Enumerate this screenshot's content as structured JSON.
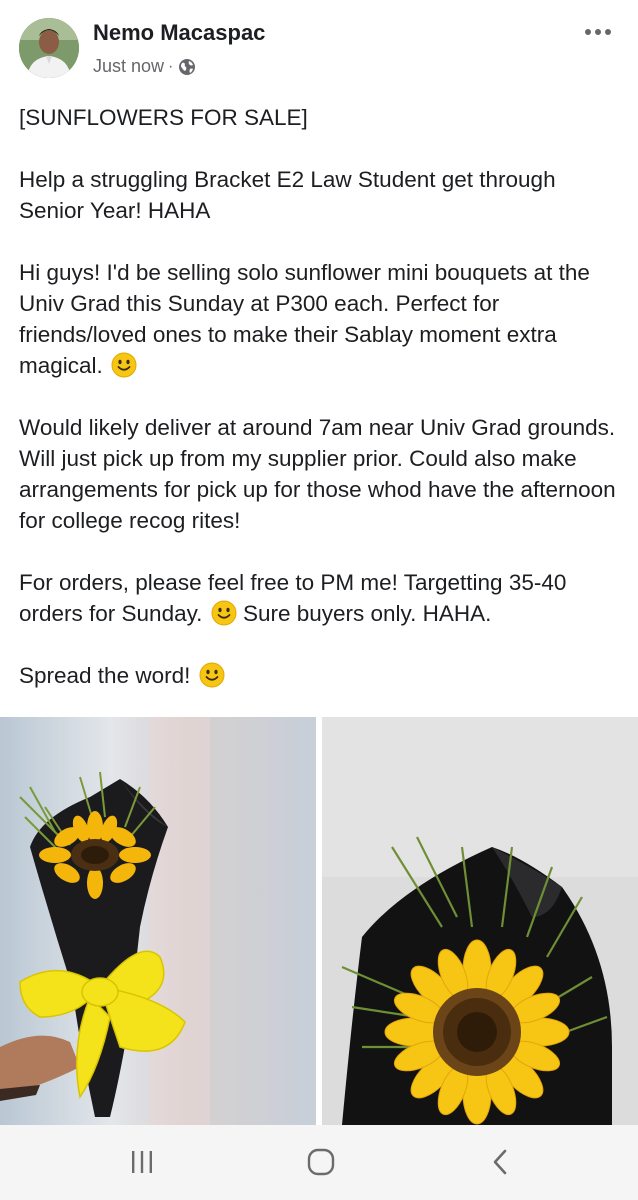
{
  "post": {
    "author": {
      "name": "Nemo Macaspac",
      "avatar_icon": "profile-photo"
    },
    "timestamp": "Just now",
    "separator": "·",
    "privacy_icon": "globe-icon",
    "more_icon": "more-options-icon",
    "paragraphs": [
      {
        "text": "[SUNFLOWERS FOR SALE]",
        "emoji_after": false
      },
      {
        "text": "Help a struggling Bracket E2 Law Student get through Senior Year! HAHA",
        "emoji_after": false
      },
      {
        "text": "Hi guys! I'd be selling solo sunflower mini bouquets at the Univ Grad this Sunday at P300 each. Perfect for friends/loved ones to make their Sablay moment extra magical.",
        "emoji_after": true
      },
      {
        "text": "Would likely deliver at around 7am near Univ Grad grounds. Will just pick up from my supplier prior. Could also make arrangements for pick up for those whod have the afternoon for college recog rites!",
        "emoji_after": false
      },
      {
        "text_before": "For orders, please feel free to PM me! Targetting 35-40 orders for Sunday.",
        "text_after": "Sure buyers only. HAHA."
      },
      {
        "text": "Spread the word!",
        "emoji_after": true
      }
    ],
    "photos": [
      {
        "subject": "sunflower-bouquet-yellow-ribbon"
      },
      {
        "subject": "sunflower-bouquet-closeup"
      }
    ]
  },
  "system_nav": {
    "recents_icon": "recent-apps-icon",
    "home_icon": "home-icon",
    "back_icon": "back-icon",
    "background": "#f5f5f5"
  },
  "colors": {
    "text": "#1c1e21",
    "meta": "#65676b",
    "sunflower": "#f7c614"
  }
}
